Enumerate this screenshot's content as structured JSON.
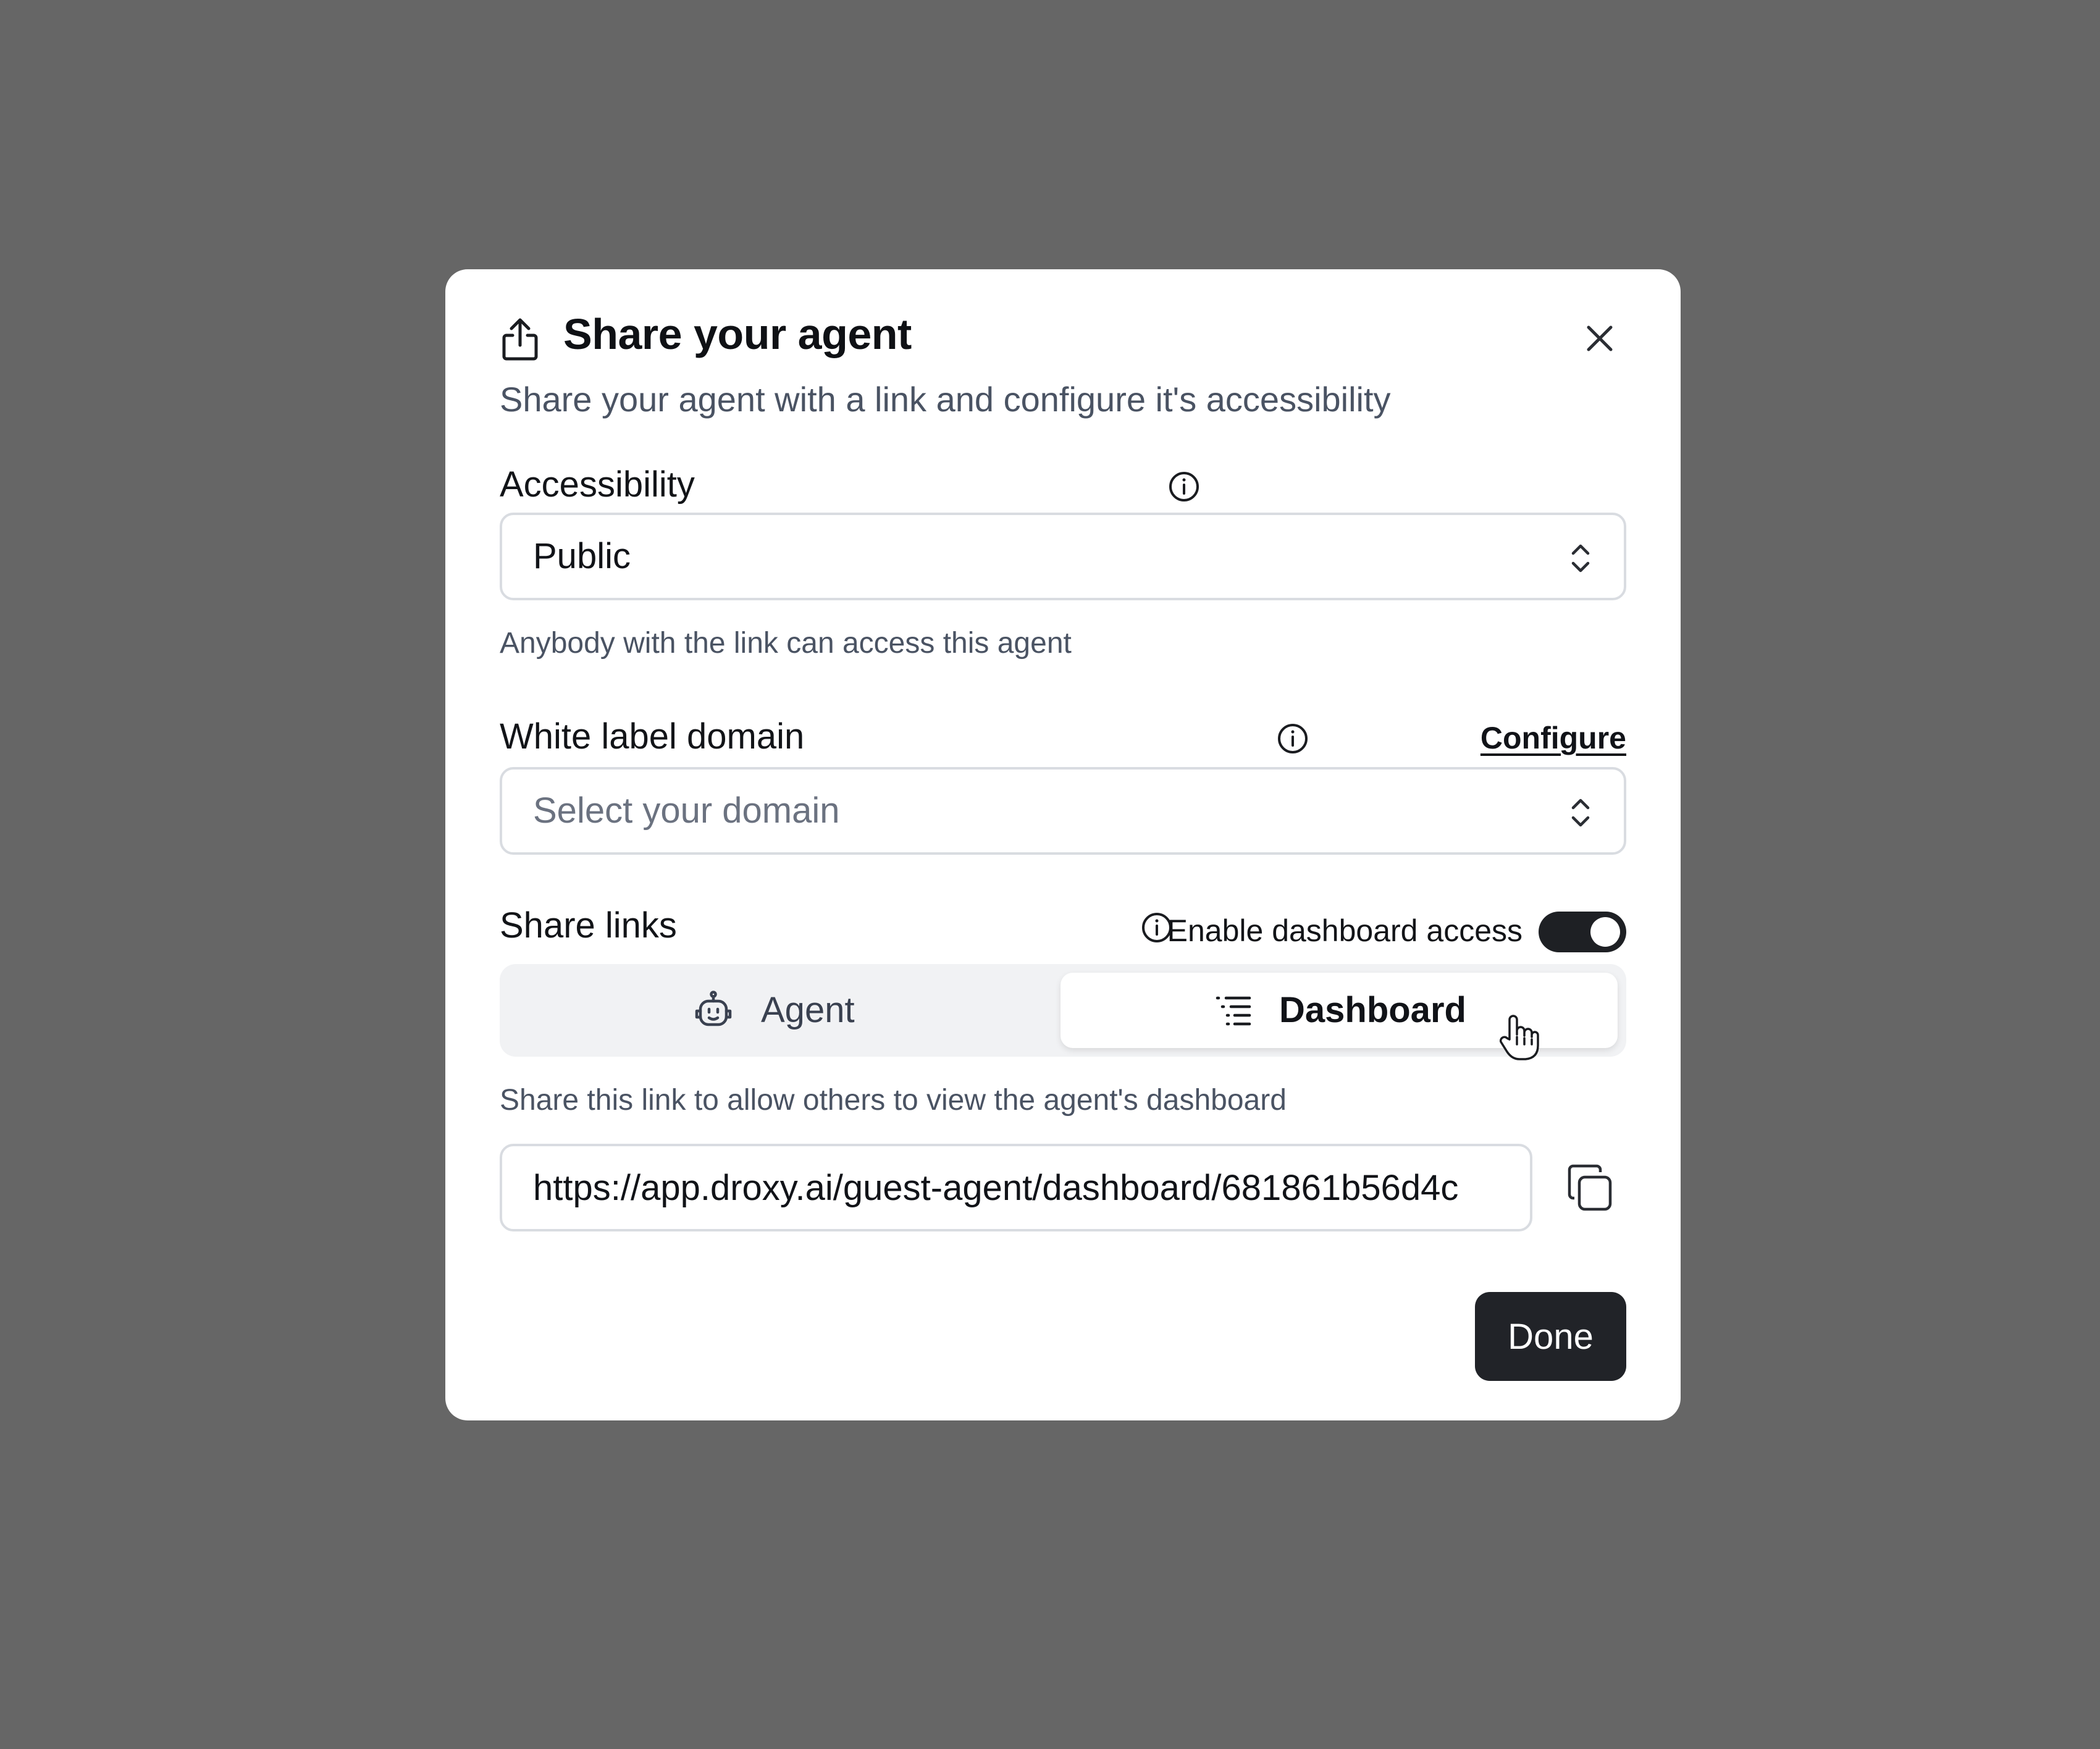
{
  "dialog": {
    "title": "Share your agent",
    "subtitle": "Share your agent with a link and configure it's accessibility",
    "done_label": "Done"
  },
  "accessibility": {
    "label": "Accessibility",
    "selected": "Public",
    "helper": "Anybody with the link can access this agent"
  },
  "white_label": {
    "label": "White label domain",
    "configure_label": "Configure",
    "placeholder": "Select your domain"
  },
  "share_links": {
    "label": "Share links",
    "dashboard_toggle_label": "Enable dashboard access",
    "dashboard_access_enabled": true,
    "tabs": [
      {
        "label": "Agent",
        "icon": "robot-icon",
        "selected": false
      },
      {
        "label": "Dashboard",
        "icon": "list-icon",
        "selected": true
      }
    ],
    "helper": "Share this link to allow others to view the agent's dashboard",
    "url": "https://app.droxy.ai/guest-agent/dashboard/681861b56d4c"
  },
  "colors": {
    "backdrop": "#666666",
    "primary_button": "#212328",
    "toggle_on": "#1e2024",
    "muted_text": "#4a5363",
    "border": "#d9dce1"
  }
}
